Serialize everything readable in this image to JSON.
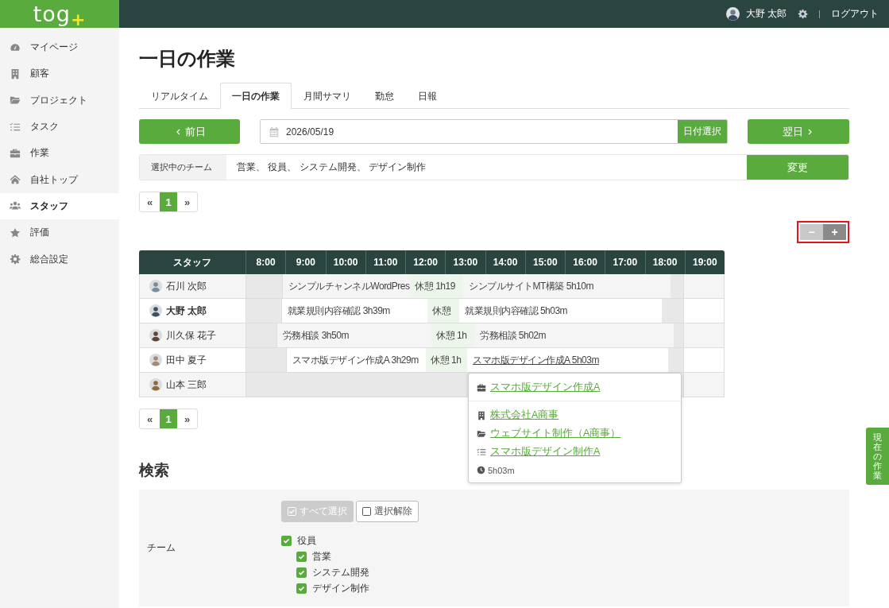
{
  "header": {
    "logo": "tog",
    "logo_mark": "+",
    "user": "大野 太郎",
    "logout": "ログアウト"
  },
  "sidebar": {
    "items": [
      {
        "label": "マイページ",
        "selected": false
      },
      {
        "label": "顧客",
        "selected": false
      },
      {
        "label": "プロジェクト",
        "selected": false
      },
      {
        "label": "タスク",
        "selected": false
      },
      {
        "label": "作業",
        "selected": false
      },
      {
        "label": "自社トップ",
        "selected": false
      },
      {
        "label": "スタッフ",
        "selected": true
      },
      {
        "label": "評価",
        "selected": false
      },
      {
        "label": "総合設定",
        "selected": false
      }
    ]
  },
  "page_title": "一日の作業",
  "tabs": [
    {
      "label": "リアルタイム",
      "selected": false
    },
    {
      "label": "一日の作業",
      "selected": true
    },
    {
      "label": "月間サマリ",
      "selected": false
    },
    {
      "label": "勤怠",
      "selected": false
    },
    {
      "label": "日報",
      "selected": false
    }
  ],
  "date_nav": {
    "prev": "前日",
    "date": "2026/05/19",
    "pick": "日付選択",
    "next": "翌日"
  },
  "team_filter": {
    "label": "選択中のチーム",
    "value": "営業、 役員、 システム開発、 デザイン制作",
    "button": "変更"
  },
  "pagination_top": [
    {
      "label": "«",
      "selected": false
    },
    {
      "label": "1",
      "selected": true
    },
    {
      "label": "»",
      "selected": false
    }
  ],
  "zoom": {
    "highlighted": true,
    "buttons": [
      {
        "label": "−",
        "disabled": true
      },
      {
        "label": "+",
        "disabled": false
      }
    ]
  },
  "timeline": {
    "staff_heading": "スタッフ",
    "hours": [
      "8:00",
      "9:00",
      "10:00",
      "11:00",
      "12:00",
      "13:00",
      "14:00",
      "15:00",
      "16:00",
      "17:00",
      "18:00",
      "19:00"
    ],
    "rows": [
      {
        "name": "石川 次郎",
        "current": false,
        "segments": [
          {
            "kind": "blank"
          },
          {
            "kind": "work",
            "text": "シンプルチャンネルWordPres",
            "hovered": false
          },
          {
            "kind": "break",
            "text": "休憩 1h19"
          },
          {
            "kind": "work",
            "text": "シンプルサイトMT構築 5h10m",
            "hovered": false
          },
          {
            "kind": "blank"
          }
        ]
      },
      {
        "name": "大野 太郎",
        "current": true,
        "segments": [
          {
            "kind": "blank"
          },
          {
            "kind": "work",
            "text": "就業規則内容確認 3h39m",
            "hovered": false
          },
          {
            "kind": "break",
            "text": "休憩"
          },
          {
            "kind": "work",
            "text": "就業規則内容確認 5h03m",
            "hovered": false
          },
          {
            "kind": "blank"
          }
        ]
      },
      {
        "name": "川久保 花子",
        "current": false,
        "segments": [
          {
            "kind": "blank"
          },
          {
            "kind": "work",
            "text": "労務相談 3h50m",
            "hovered": false
          },
          {
            "kind": "break",
            "text": "休憩 1h"
          },
          {
            "kind": "work",
            "text": "労務相談 5h02m",
            "hovered": false
          },
          {
            "kind": "blank"
          }
        ]
      },
      {
        "name": "田中 夏子",
        "current": false,
        "segments": [
          {
            "kind": "blank"
          },
          {
            "kind": "work",
            "text": "スマホ版デザイン作成A 3h29m",
            "hovered": false
          },
          {
            "kind": "break",
            "text": "休憩 1h"
          },
          {
            "kind": "work",
            "text": "スマホ版デザイン作成A 5h03m",
            "hovered": true
          },
          {
            "kind": "blank"
          }
        ]
      },
      {
        "name": "山本 三郎",
        "current": false,
        "segments": [
          {
            "kind": "blank"
          }
        ]
      }
    ],
    "popover": {
      "title": "スマホ版デザイン作成A",
      "lines": [
        {
          "kind": "client",
          "text": "株式会社A商事"
        },
        {
          "kind": "project",
          "text": "ウェブサイト制作（A商事）"
        },
        {
          "kind": "task",
          "text": "スマホ版デザイン制作A"
        }
      ],
      "duration": "5h03m"
    }
  },
  "pagination_bottom": [
    {
      "label": "«",
      "selected": false
    },
    {
      "label": "1",
      "selected": true
    },
    {
      "label": "»",
      "selected": false
    }
  ],
  "search": {
    "heading": "検索",
    "team_label": "チーム",
    "buttons": [
      {
        "kind": "select_all",
        "label": "すべて選択",
        "disabled": true
      },
      {
        "kind": "clear",
        "label": "選択解除",
        "disabled": false
      }
    ],
    "teams": [
      {
        "label": "役員",
        "checked": true,
        "children": [
          {
            "label": "営業",
            "checked": true
          },
          {
            "label": "システム開発",
            "checked": true
          },
          {
            "label": "デザイン制作",
            "checked": true
          }
        ]
      }
    ]
  },
  "side_tab": "現在の作業"
}
